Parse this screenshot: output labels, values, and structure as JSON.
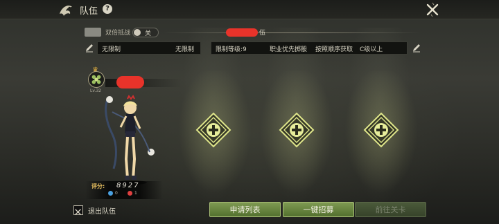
{
  "header": {
    "title": "队伍",
    "help_label": "?"
  },
  "settings": {
    "dual_label": "双倍抵战",
    "dual_toggle_state": "关",
    "team_name_suffix": "伍",
    "left_field": {
      "label": "无限制",
      "value": "无限制"
    },
    "right_field": {
      "level": "限制等级:9",
      "profession": "职业优先掷骰",
      "order": "按照顺序获取",
      "grade": "C级以上"
    }
  },
  "player": {
    "level": "Lv.32",
    "score_label": "评分:",
    "score": "8927",
    "stat_blue": "0",
    "stat_red": "1"
  },
  "slots": [
    {
      "name": "slot-1"
    },
    {
      "name": "slot-2"
    },
    {
      "name": "slot-3"
    }
  ],
  "bottom": {
    "leave_label": "退出队伍",
    "apply_list": "申请列表",
    "recruit": "一键招募",
    "go_stage": "前往关卡"
  },
  "colors": {
    "accent_green": "#7e9a52",
    "slot_glow": "#d8e07a",
    "redaction": "#e8332a"
  }
}
